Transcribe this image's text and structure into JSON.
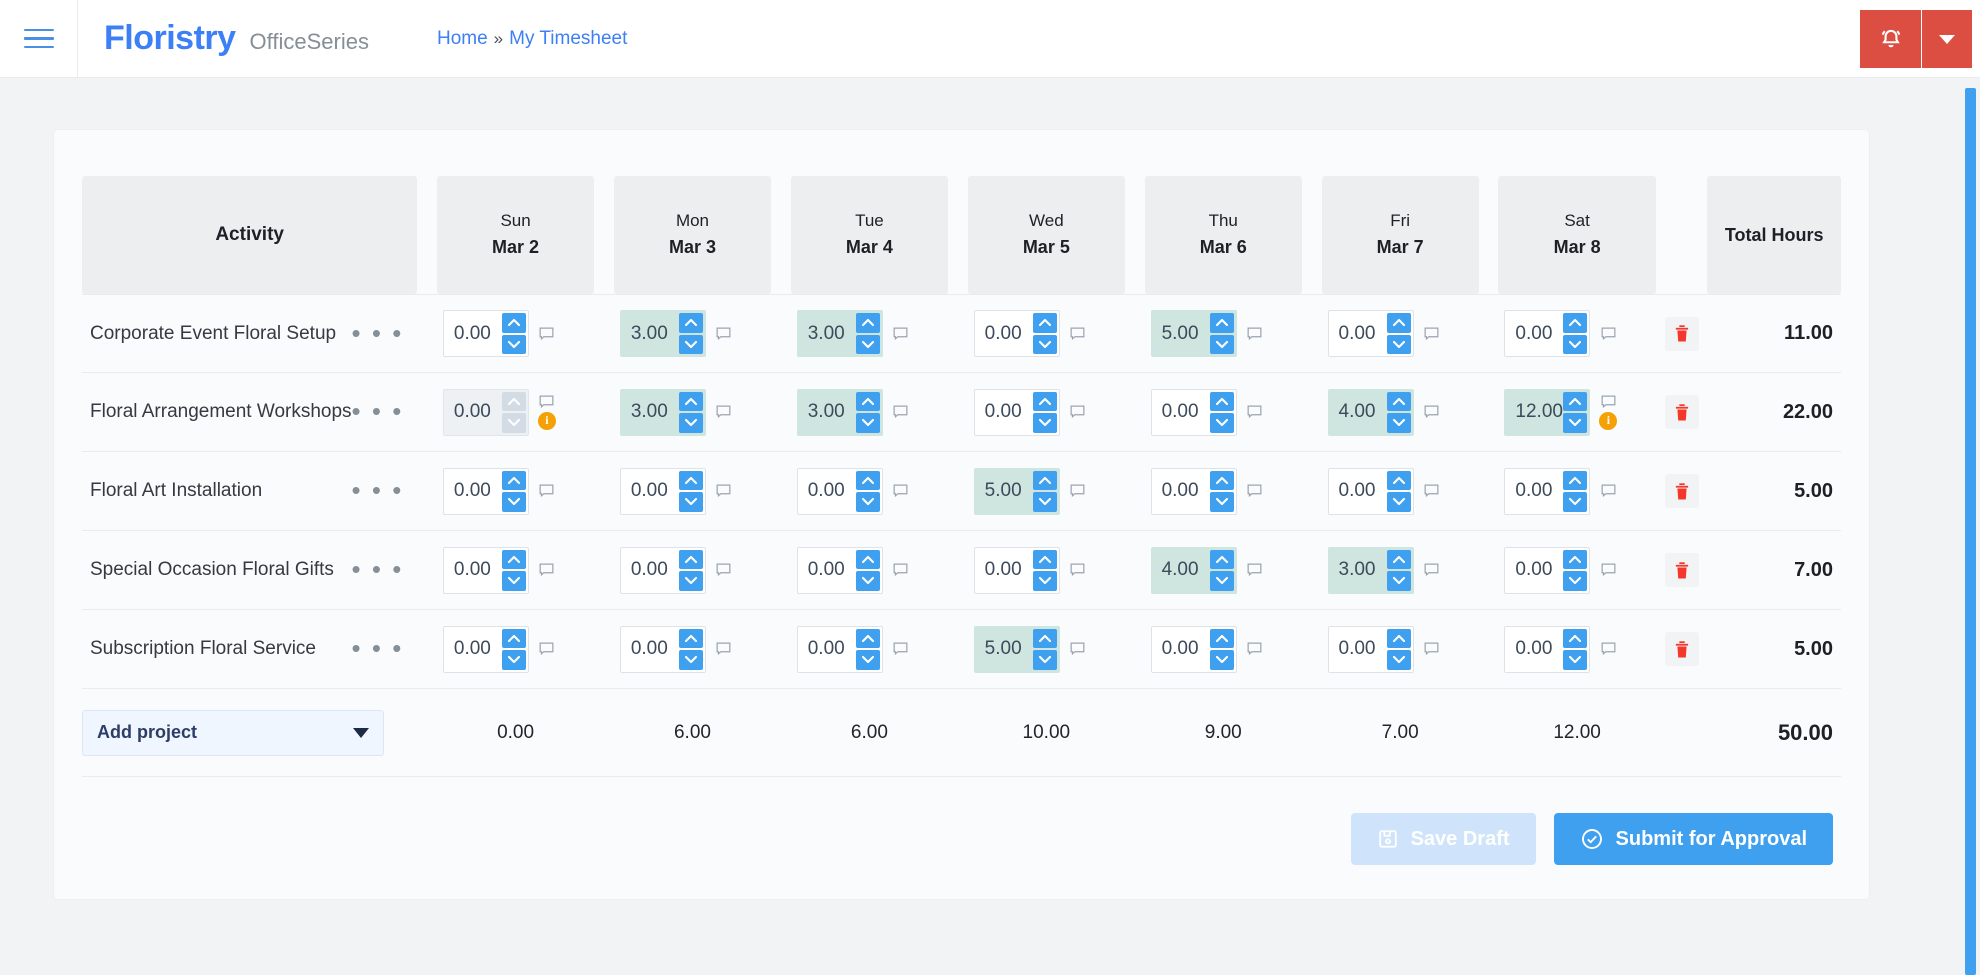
{
  "topbar": {
    "menu_icon": "hamburger-icon",
    "brand_main": "Floristry",
    "brand_sub": "OfficeSeries",
    "breadcrumb_home": "Home",
    "breadcrumb_sep": "»",
    "breadcrumb_current": "My Timesheet",
    "bell_icon": "bell-icon",
    "caret_icon": "chevron-down-icon",
    "accent_red": "#dc4e41",
    "accent_blue": "#3d7ff5"
  },
  "table": {
    "activity_header": "Activity",
    "total_header": "Total Hours",
    "days": [
      {
        "dow": "Sun",
        "dom": "Mar 2"
      },
      {
        "dow": "Mon",
        "dom": "Mar 3"
      },
      {
        "dow": "Tue",
        "dom": "Mar 4"
      },
      {
        "dow": "Wed",
        "dom": "Mar 5"
      },
      {
        "dow": "Thu",
        "dom": "Mar 6"
      },
      {
        "dow": "Fri",
        "dom": "Mar 7"
      },
      {
        "dow": "Sat",
        "dom": "Mar 8"
      }
    ],
    "row_menu_icon": "ellipsis-icon",
    "note_icon": "comment-icon",
    "info_icon": "info-badge-icon",
    "info_glyph": "i",
    "delete_icon": "trash-icon",
    "rows": [
      {
        "activity": "Corporate Event Floral Setup",
        "cells": [
          {
            "value": "0.00",
            "state": "empty",
            "info": false
          },
          {
            "value": "3.00",
            "state": "filled",
            "info": false
          },
          {
            "value": "3.00",
            "state": "filled",
            "info": false
          },
          {
            "value": "0.00",
            "state": "empty",
            "info": false
          },
          {
            "value": "5.00",
            "state": "filled",
            "info": false
          },
          {
            "value": "0.00",
            "state": "empty",
            "info": false
          },
          {
            "value": "0.00",
            "state": "empty",
            "info": false
          }
        ],
        "total": "11.00"
      },
      {
        "activity": "Floral Arrangement Workshops",
        "cells": [
          {
            "value": "0.00",
            "state": "disabled",
            "info": true
          },
          {
            "value": "3.00",
            "state": "filled",
            "info": false
          },
          {
            "value": "3.00",
            "state": "filled",
            "info": false
          },
          {
            "value": "0.00",
            "state": "empty",
            "info": false
          },
          {
            "value": "0.00",
            "state": "empty",
            "info": false
          },
          {
            "value": "4.00",
            "state": "filled",
            "info": false
          },
          {
            "value": "12.00",
            "state": "filled",
            "info": true
          }
        ],
        "total": "22.00"
      },
      {
        "activity": "Floral Art Installation",
        "cells": [
          {
            "value": "0.00",
            "state": "empty",
            "info": false
          },
          {
            "value": "0.00",
            "state": "empty",
            "info": false
          },
          {
            "value": "0.00",
            "state": "empty",
            "info": false
          },
          {
            "value": "5.00",
            "state": "filled",
            "info": false
          },
          {
            "value": "0.00",
            "state": "empty",
            "info": false
          },
          {
            "value": "0.00",
            "state": "empty",
            "info": false
          },
          {
            "value": "0.00",
            "state": "empty",
            "info": false
          }
        ],
        "total": "5.00"
      },
      {
        "activity": "Special Occasion Floral Gifts",
        "cells": [
          {
            "value": "0.00",
            "state": "empty",
            "info": false
          },
          {
            "value": "0.00",
            "state": "empty",
            "info": false
          },
          {
            "value": "0.00",
            "state": "empty",
            "info": false
          },
          {
            "value": "0.00",
            "state": "empty",
            "info": false
          },
          {
            "value": "4.00",
            "state": "filled",
            "info": false
          },
          {
            "value": "3.00",
            "state": "filled",
            "info": false
          },
          {
            "value": "0.00",
            "state": "empty",
            "info": false
          }
        ],
        "total": "7.00"
      },
      {
        "activity": "Subscription Floral Service",
        "cells": [
          {
            "value": "0.00",
            "state": "empty",
            "info": false
          },
          {
            "value": "0.00",
            "state": "empty",
            "info": false
          },
          {
            "value": "0.00",
            "state": "empty",
            "info": false
          },
          {
            "value": "5.00",
            "state": "filled",
            "info": false
          },
          {
            "value": "0.00",
            "state": "empty",
            "info": false
          },
          {
            "value": "0.00",
            "state": "empty",
            "info": false
          },
          {
            "value": "0.00",
            "state": "empty",
            "info": false
          }
        ],
        "total": "5.00"
      }
    ],
    "add_project_label": "Add project",
    "column_totals": [
      "0.00",
      "6.00",
      "6.00",
      "10.00",
      "9.00",
      "7.00",
      "12.00"
    ],
    "grand_total": "50.00"
  },
  "actions": {
    "save_draft_label": "Save Draft",
    "save_draft_icon": "save-icon",
    "submit_label": "Submit for Approval",
    "submit_icon": "check-circle-icon"
  }
}
